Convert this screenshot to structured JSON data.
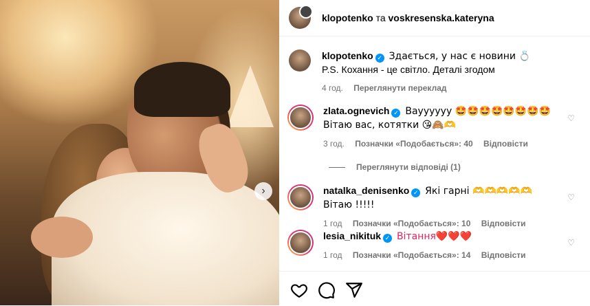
{
  "header": {
    "user1": "klopotenko",
    "conjunction": "та",
    "user2": "voskresenska.kateryna"
  },
  "caption": {
    "user": "klopotenko",
    "line1": "Здається, у нас є новини 💍",
    "line2": "P.S. Кохання - це світло. Деталі згодом",
    "time": "4 год.",
    "translate": "Переглянути переклад"
  },
  "comments": [
    {
      "user": "zlata.ognevich",
      "text": "Вауууууу 🤩🤩🤩🤩🤩🤩🤩🤩 Вітаю вас, котятки 😘🙈🫶",
      "time": "3 год.",
      "likes": "Позначки «Подобається»: 40",
      "reply": "Відповісти"
    },
    {
      "user": "natalka_denisenko",
      "text": "Які гарні 🫶🫶🫶🫶🫶 Вітаю !!!!!",
      "time": "1 год",
      "likes": "Позначки «Подобається»: 10",
      "reply": "Відповісти"
    },
    {
      "user": "lesia_nikituk",
      "text": "Вітання❤️❤️❤️",
      "time": "1 год",
      "likes": "Позначки «Подобається»: 14",
      "reply": "Відповісти"
    }
  ],
  "view_replies": "Переглянути відповіді (1)",
  "icons": {
    "verified": "✓",
    "like": "heart-icon",
    "comment": "comment-icon",
    "share": "share-icon",
    "next": "chevron-right-icon"
  },
  "colors": {
    "verified": "#0095f6",
    "meta": "#737373"
  }
}
